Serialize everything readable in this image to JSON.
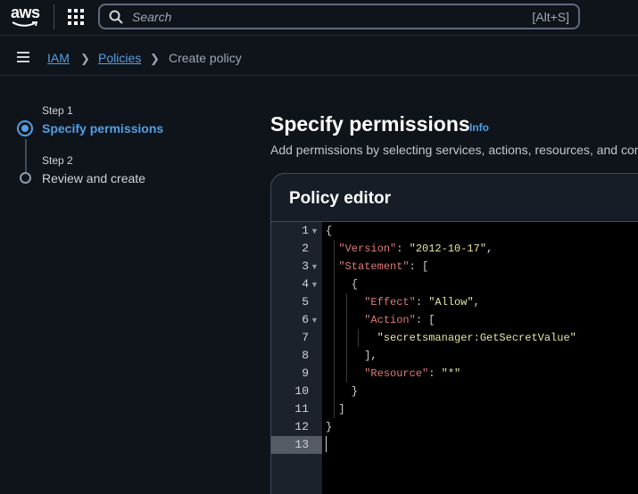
{
  "topnav": {
    "logo_text": "aws",
    "search_placeholder": "Search",
    "search_shortcut": "[Alt+S]"
  },
  "breadcrumb": {
    "items": [
      {
        "label": "IAM",
        "link": true
      },
      {
        "label": "Policies",
        "link": true
      },
      {
        "label": "Create policy",
        "link": false
      }
    ]
  },
  "steps": [
    {
      "label": "Step 1",
      "title": "Specify permissions",
      "active": true
    },
    {
      "label": "Step 2",
      "title": "Review and create",
      "active": false
    }
  ],
  "main": {
    "title": "Specify permissions",
    "info_link": "Info",
    "description": "Add permissions by selecting services, actions, resources, and con",
    "editor_title": "Policy editor"
  },
  "editor": {
    "line_numbers": [
      "1",
      "2",
      "3",
      "4",
      "5",
      "6",
      "7",
      "8",
      "9",
      "10",
      "11",
      "12",
      "13"
    ],
    "active_line": 13,
    "lines": [
      "{",
      "  \"Version\": \"2012-10-17\",",
      "  \"Statement\": [",
      "    {",
      "      \"Effect\": \"Allow\",",
      "      \"Action\": [",
      "        \"secretsmanager:GetSecretValue\"",
      "      ],",
      "      \"Resource\": \"*\"",
      "    }",
      "  ]",
      "}",
      ""
    ]
  },
  "colors": {
    "accent": "#539fe5",
    "json_key": "#e07a7a",
    "json_string": "#e6e6a0"
  }
}
